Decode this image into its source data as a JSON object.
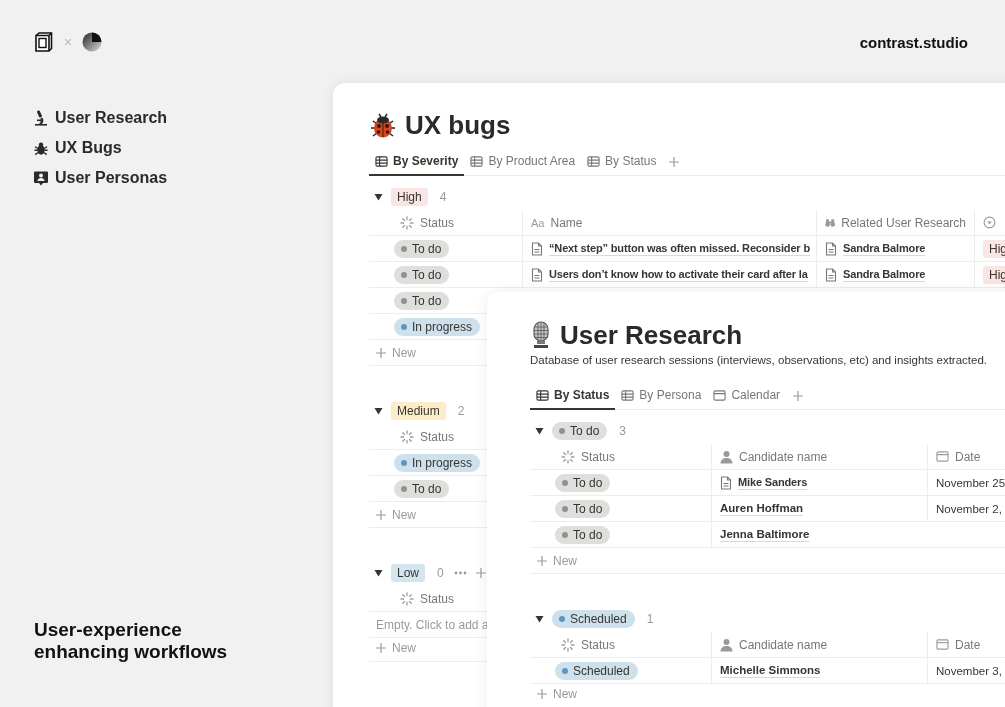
{
  "header": {
    "separator": "×",
    "brand": "contrast.studio"
  },
  "sidebar": {
    "items": [
      {
        "label": "User Research",
        "kind": "microscope"
      },
      {
        "label": "UX Bugs",
        "kind": "bug"
      },
      {
        "label": "User Personas",
        "kind": "persona"
      }
    ]
  },
  "tagline": "User-experience enhancing workflows",
  "ux_bugs": {
    "title": "UX bugs",
    "tabs": [
      {
        "label": "By Severity",
        "kind": "table",
        "selected": true
      },
      {
        "label": "By Product Area",
        "kind": "table",
        "selected": false
      },
      {
        "label": "By Status",
        "kind": "table",
        "selected": false
      }
    ],
    "groups": [
      {
        "tag": {
          "kind": "label",
          "text": "High",
          "color": "#fbe4e4"
        },
        "count": "4",
        "columns": [
          {
            "label": "Status",
            "kind": "status"
          },
          {
            "label": "Name",
            "kind": "text",
            "glyph": "Aa"
          },
          {
            "label": "Related User Research",
            "kind": "binoculars"
          },
          {
            "kind": "select"
          }
        ],
        "rows": [
          {
            "cells": [
              {
                "kind": "status",
                "text": "To do",
                "color": "#91918e"
              },
              {
                "kind": "page",
                "text": "“Next step” button was often missed. Reconsider b"
              },
              {
                "kind": "page",
                "text": "Sandra Balmore"
              },
              {
                "kind": "label",
                "text": "Hig",
                "color": "#fbe4e4"
              }
            ]
          },
          {
            "cells": [
              {
                "kind": "status",
                "text": "To do",
                "color": "#91918e"
              },
              {
                "kind": "page",
                "text": "Users don’t know how to activate their card after la"
              },
              {
                "kind": "page",
                "text": "Sandra Balmore"
              },
              {
                "kind": "label",
                "text": "Hig",
                "color": "#fbe4e4"
              }
            ]
          },
          {
            "cells": [
              {
                "kind": "status",
                "text": "To do",
                "color": "#91918e"
              }
            ]
          },
          {
            "cells": [
              {
                "kind": "status",
                "text": "In progress",
                "color": "#5b97bd"
              }
            ]
          }
        ],
        "new_label": "New"
      },
      {
        "tag": {
          "kind": "label",
          "text": "Medium",
          "color": "#fdecc8"
        },
        "count": "2",
        "columns": [
          {
            "label": "Status",
            "kind": "status"
          }
        ],
        "rows": [
          {
            "cells": [
              {
                "kind": "status",
                "text": "In progress",
                "color": "#5b97bd"
              }
            ]
          },
          {
            "cells": [
              {
                "kind": "status",
                "text": "To do",
                "color": "#91918e"
              }
            ]
          }
        ],
        "new_label": "New"
      },
      {
        "tag": {
          "kind": "label",
          "text": "Low",
          "color": "#d3e5ef"
        },
        "count": "0",
        "actions": true,
        "columns": [
          {
            "label": "Status",
            "kind": "status"
          }
        ],
        "rows": [
          {
            "cells": [
              {
                "kind": "note",
                "text": "Empty. Click to add a"
              }
            ]
          }
        ],
        "new_label": "New"
      }
    ]
  },
  "user_research": {
    "title": "User Research",
    "description": "Database of user research sessions (interviews, observations, etc) and insights extracted.",
    "tabs": [
      {
        "label": "By Status",
        "kind": "table",
        "selected": true
      },
      {
        "label": "By Persona",
        "kind": "table",
        "selected": false
      },
      {
        "label": "Calendar",
        "kind": "calendar",
        "selected": false
      }
    ],
    "groups": [
      {
        "tag": {
          "kind": "status",
          "text": "To do",
          "color": "#91918e"
        },
        "count": "3",
        "columns": [
          {
            "label": "Status",
            "kind": "status"
          },
          {
            "label": "Candidate name",
            "kind": "person"
          },
          {
            "label": "Date",
            "kind": "calendar"
          }
        ],
        "rows": [
          {
            "cells": [
              {
                "kind": "status",
                "text": "To do",
                "color": "#91918e"
              },
              {
                "kind": "page",
                "text": "Mike Sanders"
              },
              {
                "kind": "date",
                "text": "November 25"
              }
            ]
          },
          {
            "cells": [
              {
                "kind": "status",
                "text": "To do",
                "color": "#91918e"
              },
              {
                "kind": "link",
                "text": "Auren Hoffman"
              },
              {
                "kind": "date",
                "text": "November 2,"
              }
            ]
          },
          {
            "cells": [
              {
                "kind": "status",
                "text": "To do",
                "color": "#91918e"
              },
              {
                "kind": "link",
                "text": "Jenna Baltimore"
              }
            ]
          }
        ],
        "new_label": "New"
      },
      {
        "tag": {
          "kind": "status",
          "text": "Scheduled",
          "color": "#5b97bd"
        },
        "count": "1",
        "columns": [
          {
            "label": "Status",
            "kind": "status"
          },
          {
            "label": "Candidate name",
            "kind": "person"
          },
          {
            "label": "Date",
            "kind": "calendar"
          }
        ],
        "rows": [
          {
            "cells": [
              {
                "kind": "status",
                "text": "Scheduled",
                "color": "#5b97bd"
              },
              {
                "kind": "link",
                "text": "Michelle Simmons"
              },
              {
                "kind": "date",
                "text": "November 3,"
              }
            ]
          }
        ],
        "new_label": "New"
      }
    ]
  }
}
